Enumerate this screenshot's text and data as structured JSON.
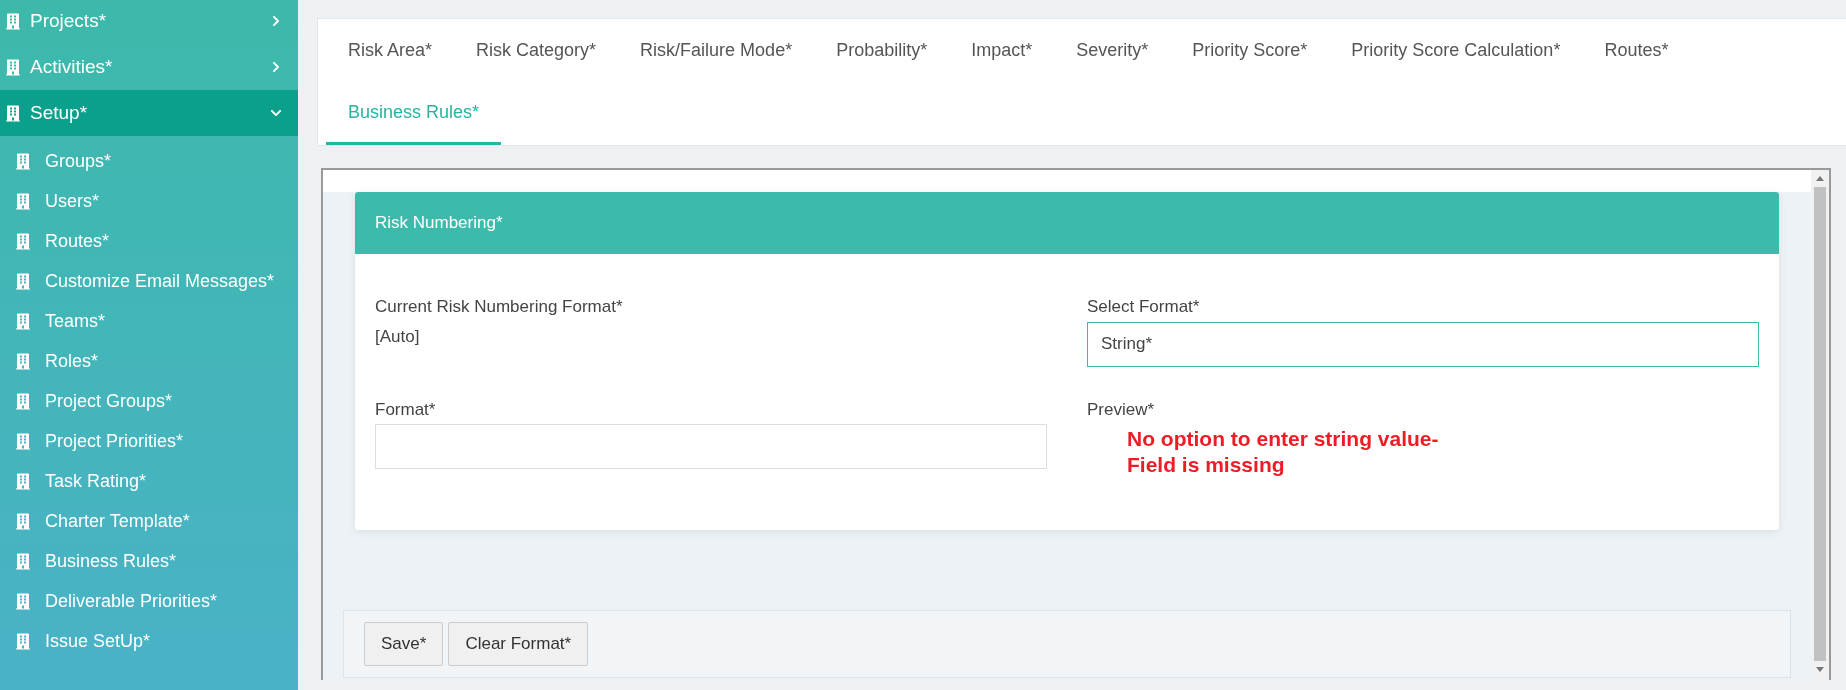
{
  "sidebar": {
    "items": [
      {
        "label": "Projects*",
        "expanded": false
      },
      {
        "label": "Activities*",
        "expanded": false
      },
      {
        "label": "Setup*",
        "expanded": true,
        "children": [
          {
            "label": "Groups*"
          },
          {
            "label": "Users*"
          },
          {
            "label": "Routes*"
          },
          {
            "label": "Customize Email Messages*"
          },
          {
            "label": "Teams*"
          },
          {
            "label": "Roles*"
          },
          {
            "label": "Project Groups*"
          },
          {
            "label": "Project Priorities*"
          },
          {
            "label": "Task Rating*"
          },
          {
            "label": "Charter Template*"
          },
          {
            "label": "Business Rules*"
          },
          {
            "label": "Deliverable Priorities*"
          },
          {
            "label": "Issue SetUp*"
          }
        ]
      }
    ]
  },
  "tabs": [
    {
      "label": "Risk Area*",
      "selected": false
    },
    {
      "label": "Risk Category*",
      "selected": false
    },
    {
      "label": "Risk/Failure Mode*",
      "selected": false
    },
    {
      "label": "Probability*",
      "selected": false
    },
    {
      "label": "Impact*",
      "selected": false
    },
    {
      "label": "Severity*",
      "selected": false
    },
    {
      "label": "Priority Score*",
      "selected": false
    },
    {
      "label": "Priority Score Calculation*",
      "selected": false
    },
    {
      "label": "Routes*",
      "selected": false
    },
    {
      "label": "Business Rules*",
      "selected": true
    }
  ],
  "panel": {
    "title": "Risk Numbering*",
    "current_format": {
      "label": "Current Risk Numbering Format*",
      "value": "[Auto]"
    },
    "select_format": {
      "label": "Select Format*",
      "value": "String*"
    },
    "format": {
      "label": "Format*"
    },
    "preview": {
      "label": "Preview*"
    },
    "annotation": [
      "No option to enter string value-",
      "Field is missing"
    ]
  },
  "buttons": [
    "Save*",
    "Clear Format*"
  ]
}
